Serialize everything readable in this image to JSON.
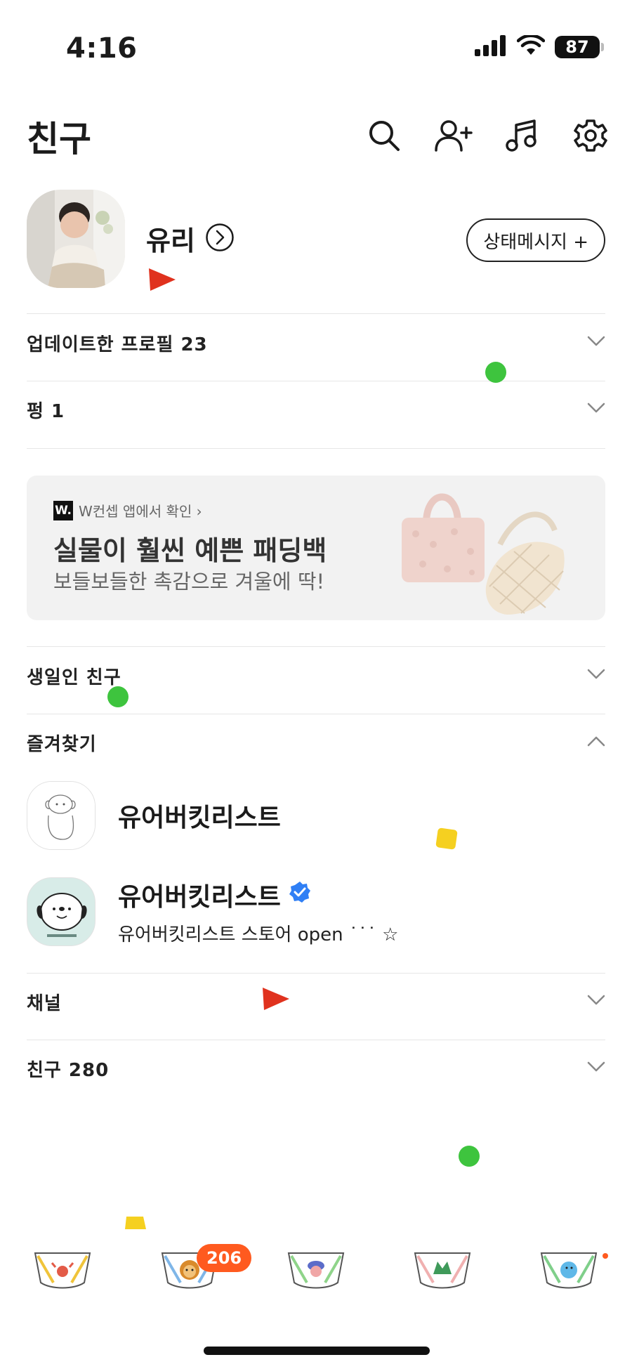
{
  "status_bar": {
    "time": "4:16",
    "battery": "87"
  },
  "header": {
    "title": "친구"
  },
  "my_profile": {
    "name": "유리",
    "status_button": "상태메시지 +"
  },
  "sections": {
    "updated_profiles": "업데이트한 프로필 23",
    "pung": "펑 1",
    "birthday": "생일인 친구",
    "favorites": "즐겨찾기",
    "channel": "채널",
    "friends": "친구 280"
  },
  "ad": {
    "source": "W컨셉 앱에서 확인 ›",
    "logo": "W.",
    "title": "실물이 훨씬 예쁜 패딩백",
    "subtitle": "보들보들한 촉감으로 겨울에 딱!"
  },
  "favorites": [
    {
      "name": "유어버킷리스트",
      "status": "",
      "verified": false
    },
    {
      "name": "유어버킷리스트",
      "status": "유어버킷리스트 스토어 open ˙˙˙ ☆",
      "verified": true
    }
  ],
  "bottom_nav": {
    "badge": "206",
    "tabs": [
      "friends-tab",
      "chats-tab",
      "openchat-tab",
      "shopping-tab",
      "more-tab"
    ]
  },
  "colors": {
    "accent_badge": "#ff5a1f",
    "verified": "#2f7ff5",
    "text": "#1b1b1b"
  }
}
